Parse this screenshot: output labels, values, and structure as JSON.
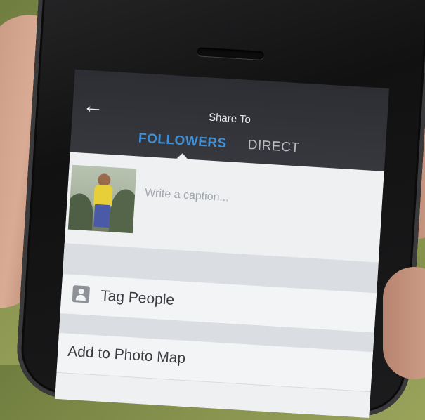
{
  "header": {
    "title": "Share To",
    "tabs": [
      {
        "label": "FOLLOWERS",
        "active": true
      },
      {
        "label": "DIRECT",
        "active": false
      }
    ]
  },
  "post": {
    "caption_placeholder": "Write a caption..."
  },
  "options": {
    "tag_people": "Tag People",
    "add_to_photo_map": "Add to Photo Map"
  },
  "colors": {
    "accent": "#3f8fd6",
    "header_bg": "#2c2e33",
    "content_bg": "#eef0f2"
  },
  "icons": {
    "back": "left-arrow-icon",
    "tag": "person-tag-icon"
  }
}
